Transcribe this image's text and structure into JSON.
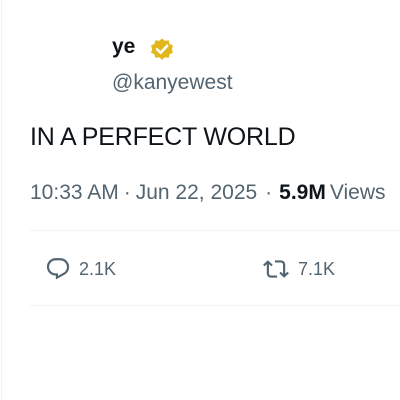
{
  "user": {
    "display_name": "ye",
    "handle": "@kanyewest",
    "verified_badge_icon": "verified-badge-icon",
    "verified_badge_color": "#e2b719"
  },
  "tweet": {
    "text": "IN A PERFECT WORLD",
    "time": "10:33 AM",
    "date": "Jun 22, 2025",
    "views_count": "5.9M",
    "views_label": "Views"
  },
  "actions": {
    "reply": {
      "icon": "reply-icon",
      "count": "2.1K"
    },
    "repost": {
      "icon": "repost-icon",
      "count": "7.1K"
    }
  }
}
